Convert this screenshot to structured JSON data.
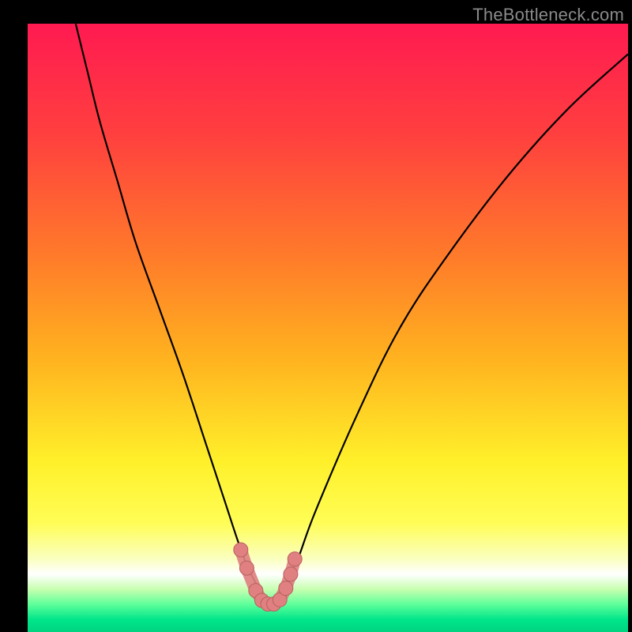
{
  "watermark": "TheBottleneck.com",
  "colors": {
    "frame": "#000000",
    "gradient_stops": [
      {
        "pos": 0.0,
        "color": "#ff1a51"
      },
      {
        "pos": 0.18,
        "color": "#ff3f3f"
      },
      {
        "pos": 0.38,
        "color": "#ff7a2a"
      },
      {
        "pos": 0.55,
        "color": "#ffb21f"
      },
      {
        "pos": 0.72,
        "color": "#fff02a"
      },
      {
        "pos": 0.82,
        "color": "#fffd55"
      },
      {
        "pos": 0.88,
        "color": "#faffc0"
      },
      {
        "pos": 0.905,
        "color": "#ffffff"
      },
      {
        "pos": 0.93,
        "color": "#c6ffb0"
      },
      {
        "pos": 0.955,
        "color": "#5cff9a"
      },
      {
        "pos": 0.98,
        "color": "#00e58a"
      },
      {
        "pos": 1.0,
        "color": "#00d482"
      }
    ],
    "curve": "#000000",
    "markers": "#e08080",
    "markers_stroke": "#b86060"
  },
  "chart_data": {
    "type": "line",
    "title": "",
    "xlabel": "",
    "ylabel": "",
    "xlim": [
      0,
      100
    ],
    "ylim": [
      0,
      100
    ],
    "series": [
      {
        "name": "bottleneck-curve",
        "x": [
          8,
          10,
          12,
          15,
          18,
          22,
          26,
          30,
          33,
          35,
          36.5,
          38,
          39,
          40,
          41,
          42,
          43,
          45,
          48,
          55,
          62,
          70,
          80,
          90,
          100
        ],
        "y": [
          100,
          92,
          84,
          74,
          64,
          53,
          42,
          30,
          21,
          15,
          11,
          8,
          6,
          5,
          5,
          6,
          8,
          12,
          20,
          36,
          50,
          62,
          75,
          86,
          95
        ]
      }
    ],
    "markers": {
      "name": "highlighted-points",
      "x": [
        35.5,
        36.5,
        38.0,
        39.0,
        40.0,
        41.0,
        42.0,
        43.0,
        43.8,
        44.5
      ],
      "y": [
        13.5,
        10.5,
        6.8,
        5.2,
        4.6,
        4.6,
        5.3,
        7.2,
        9.5,
        12.0
      ]
    }
  }
}
